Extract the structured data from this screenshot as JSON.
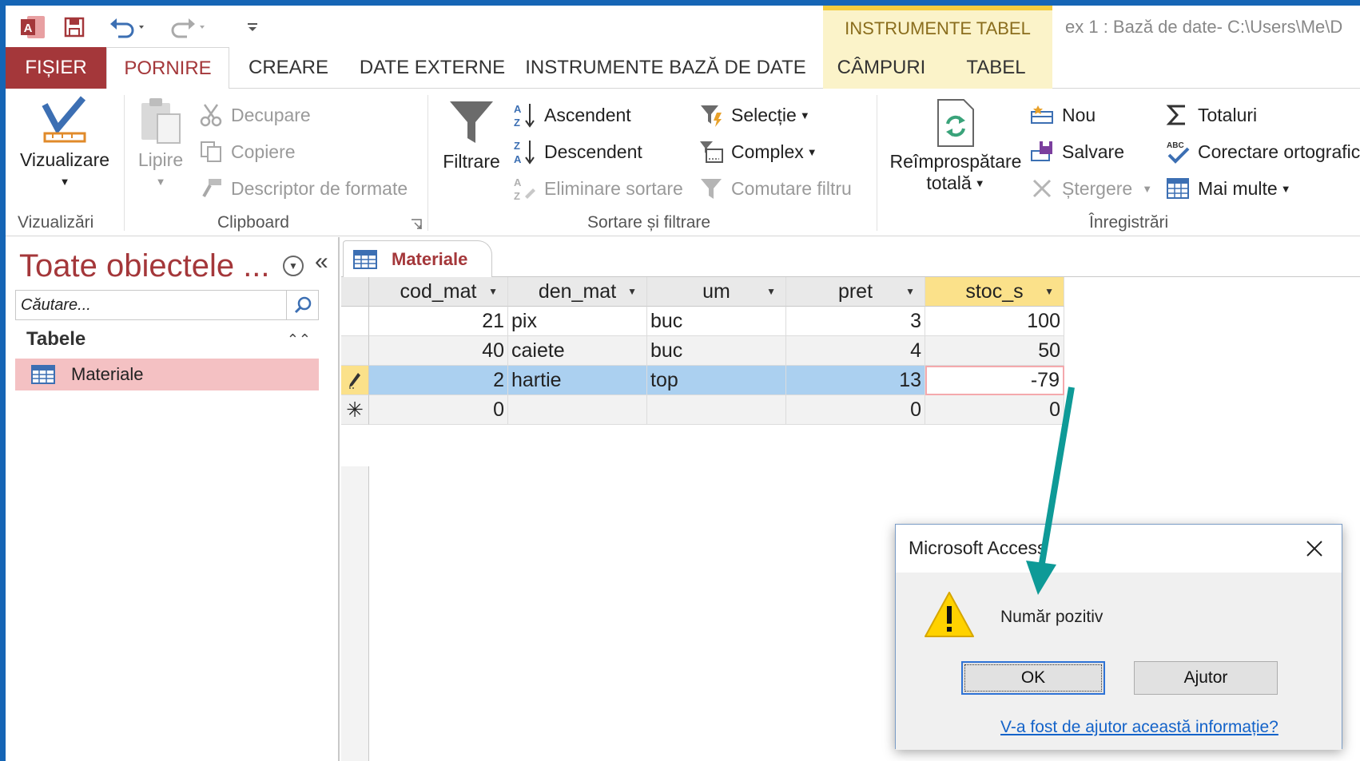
{
  "window": {
    "title": "ex 1 : Bază de date- C:\\Users\\Me\\D",
    "context_header": "INSTRUMENTE TABEL"
  },
  "tabs": [
    {
      "label": "FIȘIER"
    },
    {
      "label": "PORNIRE"
    },
    {
      "label": "CREARE"
    },
    {
      "label": "DATE EXTERNE"
    },
    {
      "label": "INSTRUMENTE BAZĂ DE DATE"
    },
    {
      "label": "CÂMPURI"
    },
    {
      "label": "TABEL"
    }
  ],
  "ribbon": {
    "view": {
      "label": "Vizualizare",
      "group": "Vizualizări"
    },
    "clipboard": {
      "paste": "Lipire",
      "cut": "Decupare",
      "copy": "Copiere",
      "format_painter": "Descriptor de formate",
      "group": "Clipboard"
    },
    "sort_filter": {
      "filter": "Filtrare",
      "ascending": "Ascendent",
      "descending": "Descendent",
      "remove_sort": "Eliminare sortare",
      "selection": "Selecție",
      "advanced": "Complex",
      "toggle_filter": "Comutare filtru",
      "group": "Sortare și filtrare"
    },
    "records": {
      "refresh_line1": "Reîmprospătare",
      "refresh_line2": "totală",
      "new": "Nou",
      "save": "Salvare",
      "delete": "Ștergere",
      "totals": "Totaluri",
      "spelling": "Corectare ortografic",
      "more": "Mai multe",
      "group": "Înregistrări"
    }
  },
  "nav": {
    "title": "Toate obiectele ...",
    "search_placeholder": "Căutare...",
    "group": "Tabele",
    "items": [
      {
        "label": "Materiale"
      }
    ]
  },
  "document": {
    "tab": "Materiale",
    "columns": [
      "cod_mat",
      "den_mat",
      "um",
      "pret",
      "stoc_s"
    ],
    "rows": [
      {
        "cod_mat": "21",
        "den_mat": "pix",
        "um": "buc",
        "pret": "3",
        "stoc_s": "100"
      },
      {
        "cod_mat": "40",
        "den_mat": "caiete",
        "um": "buc",
        "pret": "4",
        "stoc_s": "50"
      },
      {
        "cod_mat": "2",
        "den_mat": "hartie",
        "um": "top",
        "pret": "13",
        "stoc_s": "-79"
      }
    ],
    "new_row": {
      "cod_mat": "0",
      "den_mat": "",
      "um": "",
      "pret": "0",
      "stoc_s": "0"
    }
  },
  "dialog": {
    "title": "Microsoft Access",
    "message": "Număr pozitiv",
    "ok": "OK",
    "help": "Ajutor",
    "link": "V-a fost de ajutor această informație?"
  },
  "colors": {
    "accent": "#a4373a",
    "frame": "#1565b5",
    "selected_row": "#abd0f0",
    "context_tab": "#fbf3c9",
    "arrow": "#0e9a97"
  }
}
